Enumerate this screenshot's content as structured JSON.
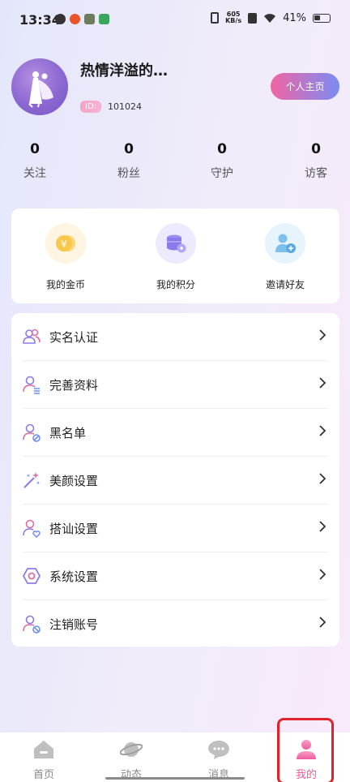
{
  "status_bar": {
    "time": "13:34",
    "net_speed_value": "605",
    "net_speed_unit": "KB/s",
    "battery": "41%"
  },
  "profile": {
    "nickname": "热情洋溢的…",
    "id_label": "ID:",
    "id_value": "101024",
    "homepage_button": "个人主页"
  },
  "stats": [
    {
      "value": "0",
      "label": "关注"
    },
    {
      "value": "0",
      "label": "粉丝"
    },
    {
      "value": "0",
      "label": "守护"
    },
    {
      "value": "0",
      "label": "访客"
    }
  ],
  "quick_actions": [
    {
      "label": "我的金币",
      "icon": "coin-icon"
    },
    {
      "label": "我的积分",
      "icon": "points-icon"
    },
    {
      "label": "邀请好友",
      "icon": "invite-friend-icon"
    }
  ],
  "menu": [
    {
      "label": "实名认证",
      "icon": "real-name-auth-icon"
    },
    {
      "label": "完善资料",
      "icon": "profile-edit-icon"
    },
    {
      "label": "黑名单",
      "icon": "blacklist-icon"
    },
    {
      "label": "美颜设置",
      "icon": "beauty-wand-icon"
    },
    {
      "label": "搭讪设置",
      "icon": "chat-up-icon"
    },
    {
      "label": "系统设置",
      "icon": "system-settings-icon"
    },
    {
      "label": "注销账号",
      "icon": "cancel-account-icon"
    }
  ],
  "bottom_nav": [
    {
      "label": "首页",
      "icon": "home-icon"
    },
    {
      "label": "动态",
      "icon": "planet-icon"
    },
    {
      "label": "消息",
      "icon": "message-icon"
    },
    {
      "label": "我的",
      "icon": "profile-icon",
      "active": true
    }
  ],
  "colors": {
    "accent_pink": "#ef5b9c",
    "accent_purple": "#7a8cf3",
    "highlight_red": "#e0232b"
  }
}
